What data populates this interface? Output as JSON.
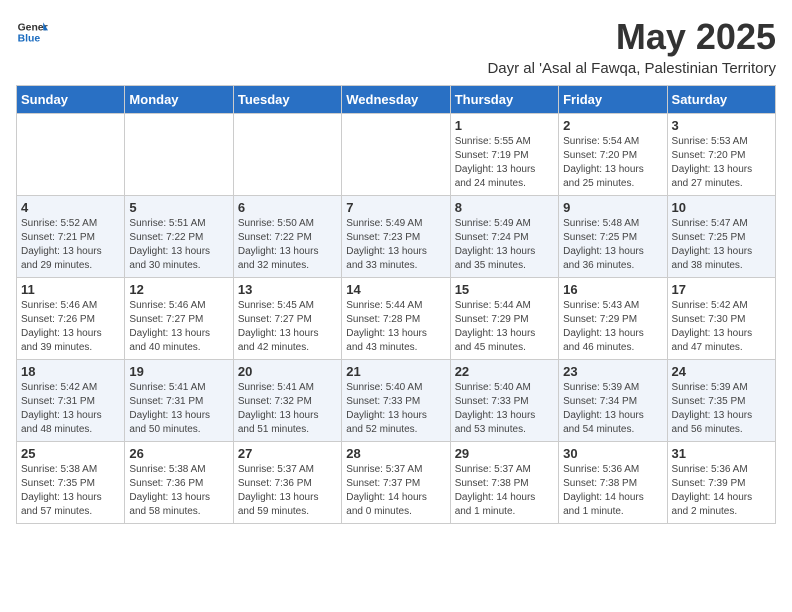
{
  "logo": {
    "general": "General",
    "blue": "Blue"
  },
  "title": "May 2025",
  "location": "Dayr al 'Asal al Fawqa, Palestinian Territory",
  "headers": [
    "Sunday",
    "Monday",
    "Tuesday",
    "Wednesday",
    "Thursday",
    "Friday",
    "Saturday"
  ],
  "weeks": [
    [
      {
        "day": "",
        "info": ""
      },
      {
        "day": "",
        "info": ""
      },
      {
        "day": "",
        "info": ""
      },
      {
        "day": "",
        "info": ""
      },
      {
        "day": "1",
        "info": "Sunrise: 5:55 AM\nSunset: 7:19 PM\nDaylight: 13 hours\nand 24 minutes."
      },
      {
        "day": "2",
        "info": "Sunrise: 5:54 AM\nSunset: 7:20 PM\nDaylight: 13 hours\nand 25 minutes."
      },
      {
        "day": "3",
        "info": "Sunrise: 5:53 AM\nSunset: 7:20 PM\nDaylight: 13 hours\nand 27 minutes."
      }
    ],
    [
      {
        "day": "4",
        "info": "Sunrise: 5:52 AM\nSunset: 7:21 PM\nDaylight: 13 hours\nand 29 minutes."
      },
      {
        "day": "5",
        "info": "Sunrise: 5:51 AM\nSunset: 7:22 PM\nDaylight: 13 hours\nand 30 minutes."
      },
      {
        "day": "6",
        "info": "Sunrise: 5:50 AM\nSunset: 7:22 PM\nDaylight: 13 hours\nand 32 minutes."
      },
      {
        "day": "7",
        "info": "Sunrise: 5:49 AM\nSunset: 7:23 PM\nDaylight: 13 hours\nand 33 minutes."
      },
      {
        "day": "8",
        "info": "Sunrise: 5:49 AM\nSunset: 7:24 PM\nDaylight: 13 hours\nand 35 minutes."
      },
      {
        "day": "9",
        "info": "Sunrise: 5:48 AM\nSunset: 7:25 PM\nDaylight: 13 hours\nand 36 minutes."
      },
      {
        "day": "10",
        "info": "Sunrise: 5:47 AM\nSunset: 7:25 PM\nDaylight: 13 hours\nand 38 minutes."
      }
    ],
    [
      {
        "day": "11",
        "info": "Sunrise: 5:46 AM\nSunset: 7:26 PM\nDaylight: 13 hours\nand 39 minutes."
      },
      {
        "day": "12",
        "info": "Sunrise: 5:46 AM\nSunset: 7:27 PM\nDaylight: 13 hours\nand 40 minutes."
      },
      {
        "day": "13",
        "info": "Sunrise: 5:45 AM\nSunset: 7:27 PM\nDaylight: 13 hours\nand 42 minutes."
      },
      {
        "day": "14",
        "info": "Sunrise: 5:44 AM\nSunset: 7:28 PM\nDaylight: 13 hours\nand 43 minutes."
      },
      {
        "day": "15",
        "info": "Sunrise: 5:44 AM\nSunset: 7:29 PM\nDaylight: 13 hours\nand 45 minutes."
      },
      {
        "day": "16",
        "info": "Sunrise: 5:43 AM\nSunset: 7:29 PM\nDaylight: 13 hours\nand 46 minutes."
      },
      {
        "day": "17",
        "info": "Sunrise: 5:42 AM\nSunset: 7:30 PM\nDaylight: 13 hours\nand 47 minutes."
      }
    ],
    [
      {
        "day": "18",
        "info": "Sunrise: 5:42 AM\nSunset: 7:31 PM\nDaylight: 13 hours\nand 48 minutes."
      },
      {
        "day": "19",
        "info": "Sunrise: 5:41 AM\nSunset: 7:31 PM\nDaylight: 13 hours\nand 50 minutes."
      },
      {
        "day": "20",
        "info": "Sunrise: 5:41 AM\nSunset: 7:32 PM\nDaylight: 13 hours\nand 51 minutes."
      },
      {
        "day": "21",
        "info": "Sunrise: 5:40 AM\nSunset: 7:33 PM\nDaylight: 13 hours\nand 52 minutes."
      },
      {
        "day": "22",
        "info": "Sunrise: 5:40 AM\nSunset: 7:33 PM\nDaylight: 13 hours\nand 53 minutes."
      },
      {
        "day": "23",
        "info": "Sunrise: 5:39 AM\nSunset: 7:34 PM\nDaylight: 13 hours\nand 54 minutes."
      },
      {
        "day": "24",
        "info": "Sunrise: 5:39 AM\nSunset: 7:35 PM\nDaylight: 13 hours\nand 56 minutes."
      }
    ],
    [
      {
        "day": "25",
        "info": "Sunrise: 5:38 AM\nSunset: 7:35 PM\nDaylight: 13 hours\nand 57 minutes."
      },
      {
        "day": "26",
        "info": "Sunrise: 5:38 AM\nSunset: 7:36 PM\nDaylight: 13 hours\nand 58 minutes."
      },
      {
        "day": "27",
        "info": "Sunrise: 5:37 AM\nSunset: 7:36 PM\nDaylight: 13 hours\nand 59 minutes."
      },
      {
        "day": "28",
        "info": "Sunrise: 5:37 AM\nSunset: 7:37 PM\nDaylight: 14 hours\nand 0 minutes."
      },
      {
        "day": "29",
        "info": "Sunrise: 5:37 AM\nSunset: 7:38 PM\nDaylight: 14 hours\nand 1 minute."
      },
      {
        "day": "30",
        "info": "Sunrise: 5:36 AM\nSunset: 7:38 PM\nDaylight: 14 hours\nand 1 minute."
      },
      {
        "day": "31",
        "info": "Sunrise: 5:36 AM\nSunset: 7:39 PM\nDaylight: 14 hours\nand 2 minutes."
      }
    ]
  ]
}
